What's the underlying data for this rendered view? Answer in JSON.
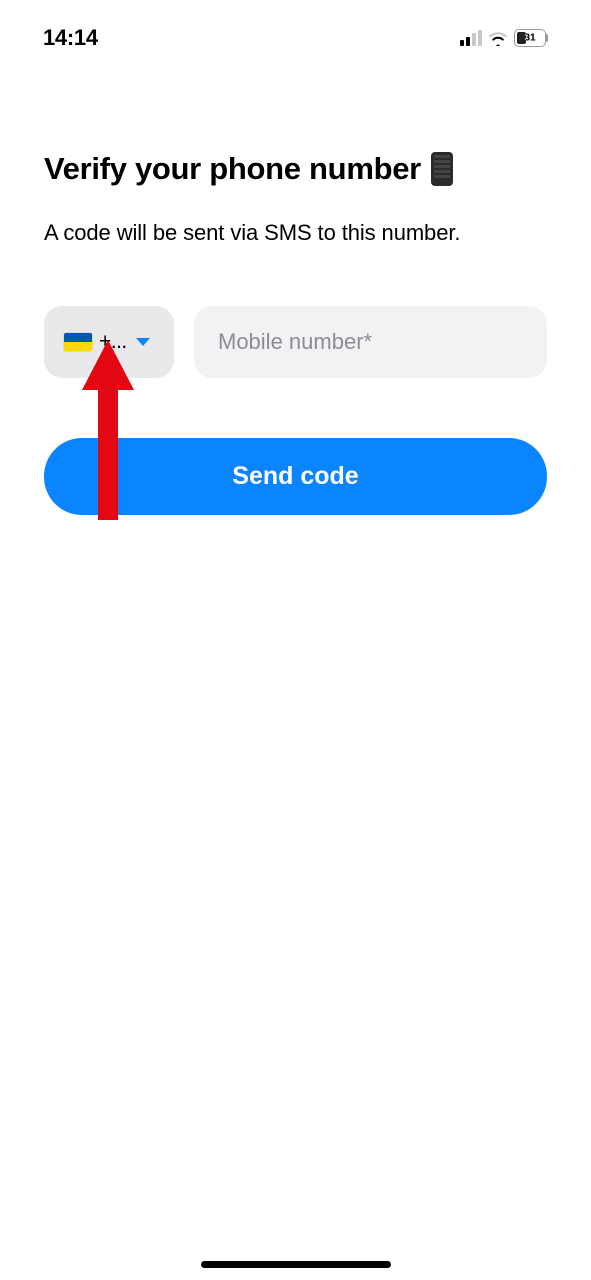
{
  "status": {
    "time": "14:14",
    "battery_level": "31"
  },
  "heading": {
    "title": "Verify your phone number"
  },
  "subtitle": "A code will be sent via SMS to this number.",
  "form": {
    "country_code_label": "+...",
    "phone_placeholder": "Mobile number*",
    "phone_value": "",
    "button_label": "Send code"
  },
  "colors": {
    "primary": "#0a84ff"
  }
}
